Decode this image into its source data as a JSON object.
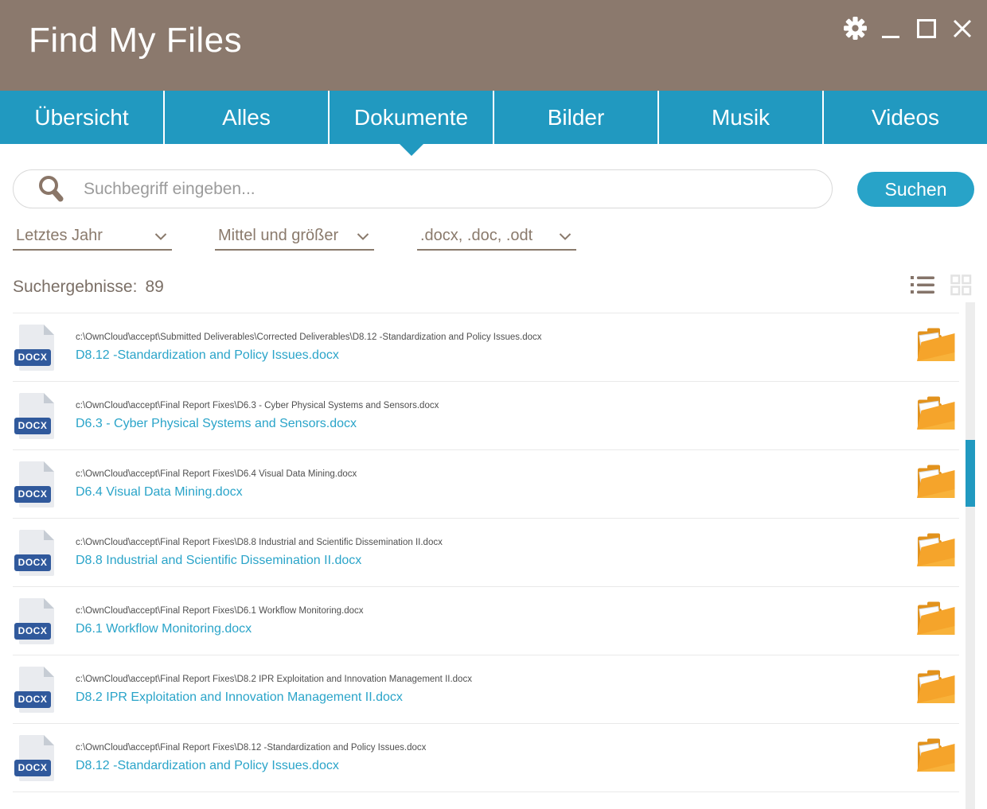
{
  "window": {
    "title": "Find My Files",
    "controls": {
      "settings": "gear-icon",
      "minimize": "minimize-icon",
      "maximize": "maximize-icon",
      "close": "close-icon"
    }
  },
  "tabs": [
    {
      "label": "Übersicht",
      "active": false
    },
    {
      "label": "Alles",
      "active": false
    },
    {
      "label": "Dokumente",
      "active": true
    },
    {
      "label": "Bilder",
      "active": false
    },
    {
      "label": "Musik",
      "active": false
    },
    {
      "label": "Videos",
      "active": false
    }
  ],
  "search": {
    "placeholder": "Suchbegriff eingeben...",
    "button_label": "Suchen",
    "icon": "search-icon"
  },
  "filters": [
    {
      "value": "Letztes Jahr"
    },
    {
      "value": "Mittel und größer"
    },
    {
      "value": ".docx, .doc, .odt"
    }
  ],
  "results": {
    "header_label": "Suchergebnisse:",
    "count": "89",
    "view_icons": {
      "list": "list-view-icon",
      "grid": "grid-view-icon"
    },
    "file_badge": "DOCX",
    "items": [
      {
        "path": "c:\\OwnCloud\\accept\\Submitted Deliverables\\Corrected Deliverables\\D8.12 -Standardization and Policy Issues.docx",
        "name": "D8.12 -Standardization and Policy Issues.docx"
      },
      {
        "path": "c:\\OwnCloud\\accept\\Final Report Fixes\\D6.3 - Cyber Physical Systems and Sensors.docx",
        "name": "D6.3 - Cyber Physical Systems and Sensors.docx"
      },
      {
        "path": "c:\\OwnCloud\\accept\\Final Report Fixes\\D6.4 Visual Data Mining.docx",
        "name": "D6.4 Visual Data Mining.docx"
      },
      {
        "path": "c:\\OwnCloud\\accept\\Final Report Fixes\\D8.8 Industrial and Scientific Dissemination II.docx",
        "name": "D8.8 Industrial and Scientific Dissemination II.docx"
      },
      {
        "path": "c:\\OwnCloud\\accept\\Final Report Fixes\\D6.1 Workflow Monitoring.docx",
        "name": "D6.1 Workflow Monitoring.docx"
      },
      {
        "path": "c:\\OwnCloud\\accept\\Final Report Fixes\\D8.2 IPR Exploitation and Innovation Management II.docx",
        "name": "D8.2 IPR Exploitation and Innovation Management II.docx"
      },
      {
        "path": "c:\\OwnCloud\\accept\\Final Report Fixes\\D8.12 -Standardization and Policy Issues.docx",
        "name": "D8.12 -Standardization and Policy Issues.docx"
      }
    ]
  },
  "colors": {
    "titlebar_taupe": "#8b796d",
    "accent_teal": "#2199c0",
    "button_teal": "#28a3c8",
    "link_teal": "#2aa4c9",
    "filter_taupe": "#8a7a6c",
    "docx_badge_blue": "#30599c",
    "folder_orange": "#f5a42b"
  }
}
